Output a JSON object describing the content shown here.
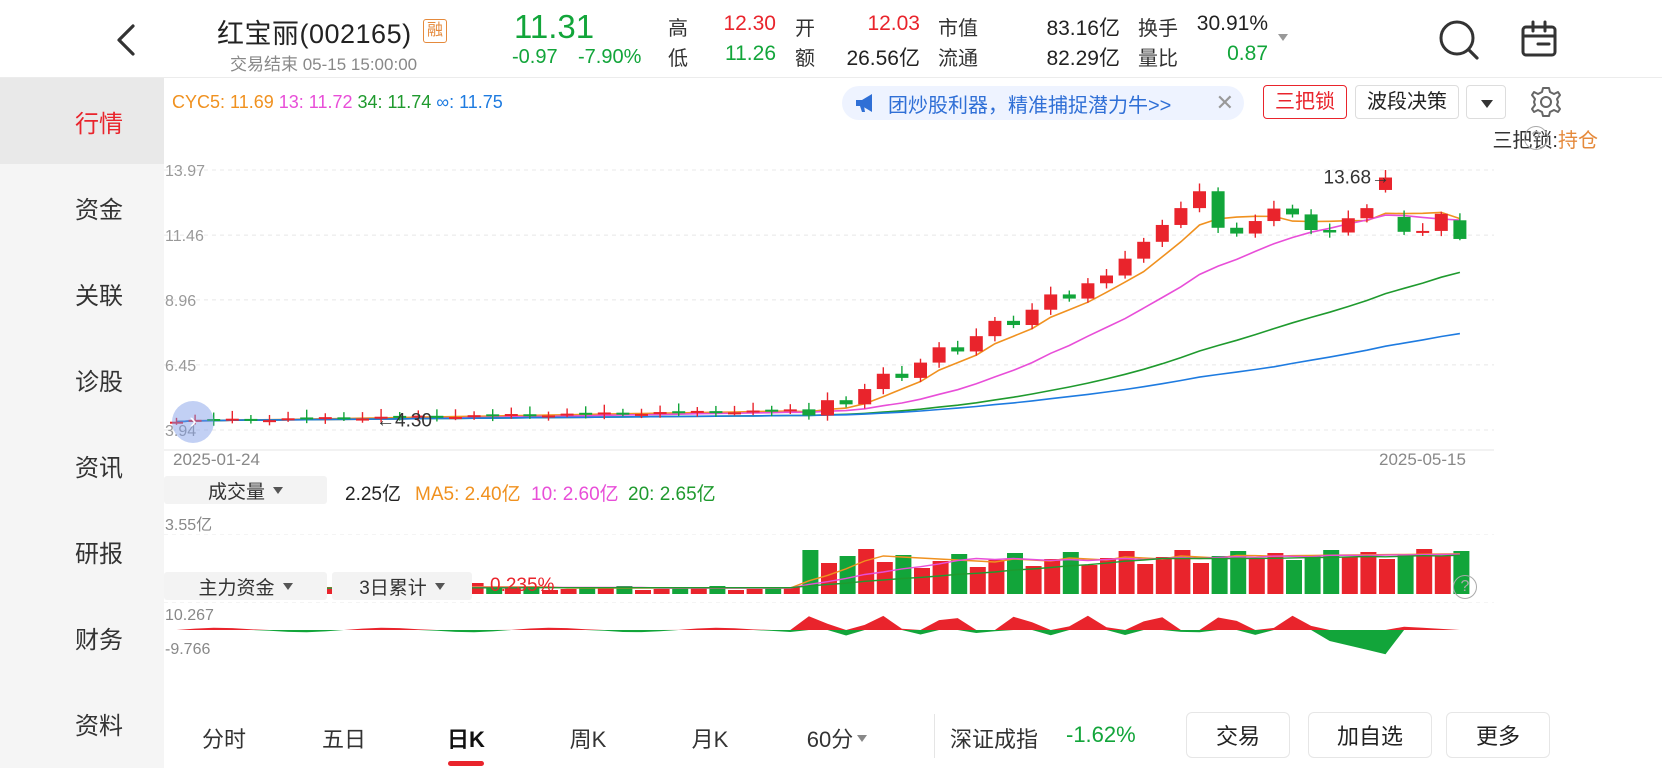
{
  "header": {
    "name": "红宝丽(002165)",
    "badge": "融",
    "status": "交易结束 05-15 15:00:00",
    "price": "11.31",
    "change": "-0.97",
    "change_pct": "-7.90%",
    "quote": {
      "high_label": "高",
      "high": "12.30",
      "open_label": "开",
      "open": "12.03",
      "mktcap_label": "市值",
      "mktcap": "83.16亿",
      "turnover_label": "换手",
      "turnover": "30.91%",
      "low_label": "低",
      "low": "11.26",
      "amount_label": "额",
      "amount": "26.56亿",
      "float_label": "流通",
      "float": "82.29亿",
      "volratio_label": "量比",
      "volratio": "0.87"
    },
    "icons": [
      "back-icon",
      "search-icon",
      "notes-icon"
    ]
  },
  "sidebar": {
    "items": [
      {
        "label": "行情",
        "active": true
      },
      {
        "label": "资金",
        "active": false
      },
      {
        "label": "关联",
        "active": false
      },
      {
        "label": "诊股",
        "active": false
      },
      {
        "label": "资讯",
        "active": false
      },
      {
        "label": "研报",
        "active": false
      },
      {
        "label": "财务",
        "active": false
      },
      {
        "label": "资料",
        "active": false
      }
    ]
  },
  "indicator": {
    "cyc5": "CYC5: 11.69",
    "c13": "13: 11.72",
    "c34": "34: 11.74",
    "cinf": "∞: 11.75",
    "colors": {
      "cyc5": "#f0911f",
      "c13": "#e84ed8",
      "c34": "#1f9a2e",
      "cinf": "#1e7be0"
    }
  },
  "toolbar": {
    "promo": "团炒股利器，精准捕捉潜力牛>>",
    "promo_close": "✕",
    "lock_btn": "三把锁",
    "band_btn": "波段决策",
    "lock_status_label": "三把锁:",
    "lock_status_value": "持仓",
    "help": "?"
  },
  "kline": {
    "y_labels": [
      "13.97",
      "11.46",
      "8.96",
      "6.45",
      "3.94"
    ],
    "y_range": [
      3.94,
      13.97
    ],
    "max_label": "13.68",
    "min_label": "4.30",
    "date_start": "2025-01-24",
    "date_end": "2025-05-15",
    "nav": "›"
  },
  "volume": {
    "selector": "成交量",
    "value": "2.25亿",
    "ma5": "MA5: 2.40亿",
    "ma10": "10: 2.60亿",
    "ma20": "20: 2.65亿",
    "scale": "3.55亿"
  },
  "flow": {
    "selector1": "主力资金",
    "selector2": "3日累计",
    "value": "0.235%",
    "max": "10.267",
    "min": "-9.766",
    "help": "?"
  },
  "tabs": {
    "items": [
      {
        "label": "分时",
        "active": false
      },
      {
        "label": "五日",
        "active": false
      },
      {
        "label": "日K",
        "active": true
      },
      {
        "label": "周K",
        "active": false
      },
      {
        "label": "月K",
        "active": false
      },
      {
        "label": "60分",
        "active": false
      }
    ]
  },
  "bottom": {
    "index_name": "深证成指",
    "index_change": "-1.62%",
    "trade": "交易",
    "add_fav": "加自选",
    "more": "更多"
  },
  "colors": {
    "up": "#e9242c",
    "down": "#12a53a",
    "accent": "#2f6fd6"
  }
}
